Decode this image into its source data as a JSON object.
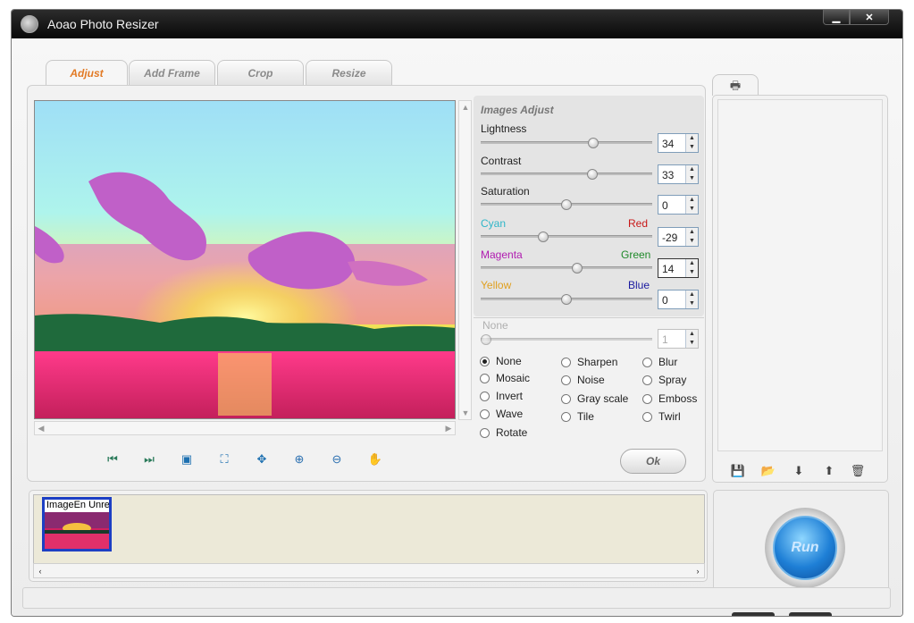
{
  "window": {
    "title": "Aoao Photo Resizer",
    "minimize": "▁",
    "close": "✕"
  },
  "tabs": [
    {
      "label": "Adjust",
      "active": true
    },
    {
      "label": "Add Frame",
      "active": false
    },
    {
      "label": "Crop",
      "active": false
    },
    {
      "label": "Resize",
      "active": false
    }
  ],
  "adjust": {
    "section_title": "Images Adjust",
    "lightness": {
      "label": "Lightness",
      "value": "34"
    },
    "contrast": {
      "label": "Contrast",
      "value": "33"
    },
    "saturation": {
      "label": "Saturation",
      "value": "0"
    },
    "cyan_red": {
      "left": "Cyan",
      "right": "Red",
      "value": "-29"
    },
    "magenta_green": {
      "left": "Magenta",
      "right": "Green",
      "value": "14"
    },
    "yellow_blue": {
      "left": "Yellow",
      "right": "Blue",
      "value": "0"
    },
    "effect": {
      "label": "None",
      "value": "1"
    }
  },
  "effects": [
    {
      "label": "None",
      "selected": true
    },
    {
      "label": "Mosaic",
      "selected": false
    },
    {
      "label": "Invert",
      "selected": false
    },
    {
      "label": "Wave",
      "selected": false
    },
    {
      "label": "Rotate",
      "selected": false
    },
    {
      "label": "Sharpen",
      "selected": false
    },
    {
      "label": "Noise",
      "selected": false
    },
    {
      "label": "Gray scale",
      "selected": false
    },
    {
      "label": "Tile",
      "selected": false
    },
    {
      "label": "Blur",
      "selected": false
    },
    {
      "label": "Spray",
      "selected": false
    },
    {
      "label": "Emboss",
      "selected": false
    },
    {
      "label": "Twirl",
      "selected": false
    }
  ],
  "colors": {
    "cyan": "#2fb6c8",
    "red": "#c81818",
    "magenta": "#b01bb0",
    "green": "#1f8a2a",
    "yellow": "#e0a020",
    "blue": "#1a1aa0",
    "accent": "#e27a25"
  },
  "toolbar_icons": [
    "first-icon",
    "last-icon",
    "fit-icon",
    "actual-size-icon",
    "move-icon",
    "zoom-in-icon",
    "zoom-out-icon",
    "hand-icon"
  ],
  "ok_label": "Ok",
  "file_buttons": [
    "save-icon",
    "open-folder-icon",
    "move-down-icon",
    "move-up-icon",
    "delete-icon"
  ],
  "thumbnail": {
    "label": "ImageEn Unre"
  },
  "run_label": "Run"
}
